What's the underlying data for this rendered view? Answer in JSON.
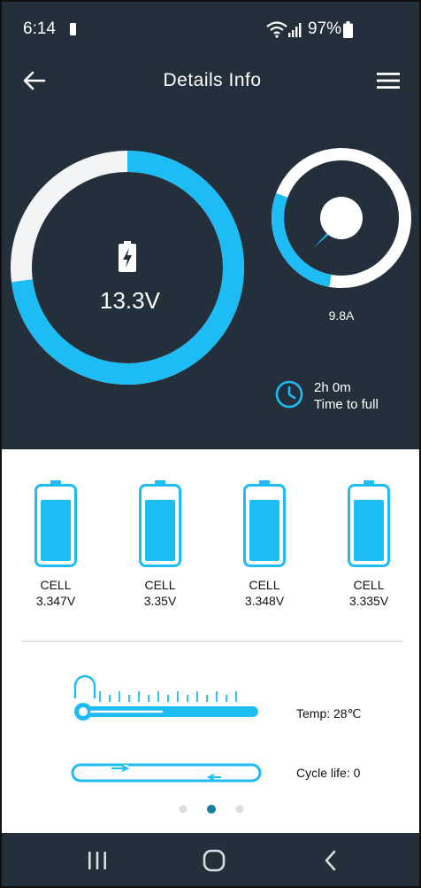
{
  "status_bar": {
    "time": "6:14",
    "battery_percent": "97%"
  },
  "app_bar": {
    "title": "Details Info"
  },
  "voltage": {
    "value": "13.3V",
    "fill_fraction": 0.73
  },
  "current": {
    "value": "9.8A",
    "fill_fraction": 0.28
  },
  "charge_time": {
    "duration": "2h 0m",
    "label": "Time to full"
  },
  "cells": [
    {
      "label": "CELL",
      "voltage": "3.347V"
    },
    {
      "label": "CELL",
      "voltage": "3.35V"
    },
    {
      "label": "CELL",
      "voltage": "3.348V"
    },
    {
      "label": "CELL",
      "voltage": "3.335V"
    }
  ],
  "temperature": {
    "label": "Temp: 28℃"
  },
  "cycle_life": {
    "label": "Cycle life: 0"
  },
  "pager": {
    "count": 3,
    "active_index": 1
  },
  "colors": {
    "accent": "#1ebcf5",
    "dark_bg": "#232f3b",
    "ring_track": "#f2f4f5"
  }
}
